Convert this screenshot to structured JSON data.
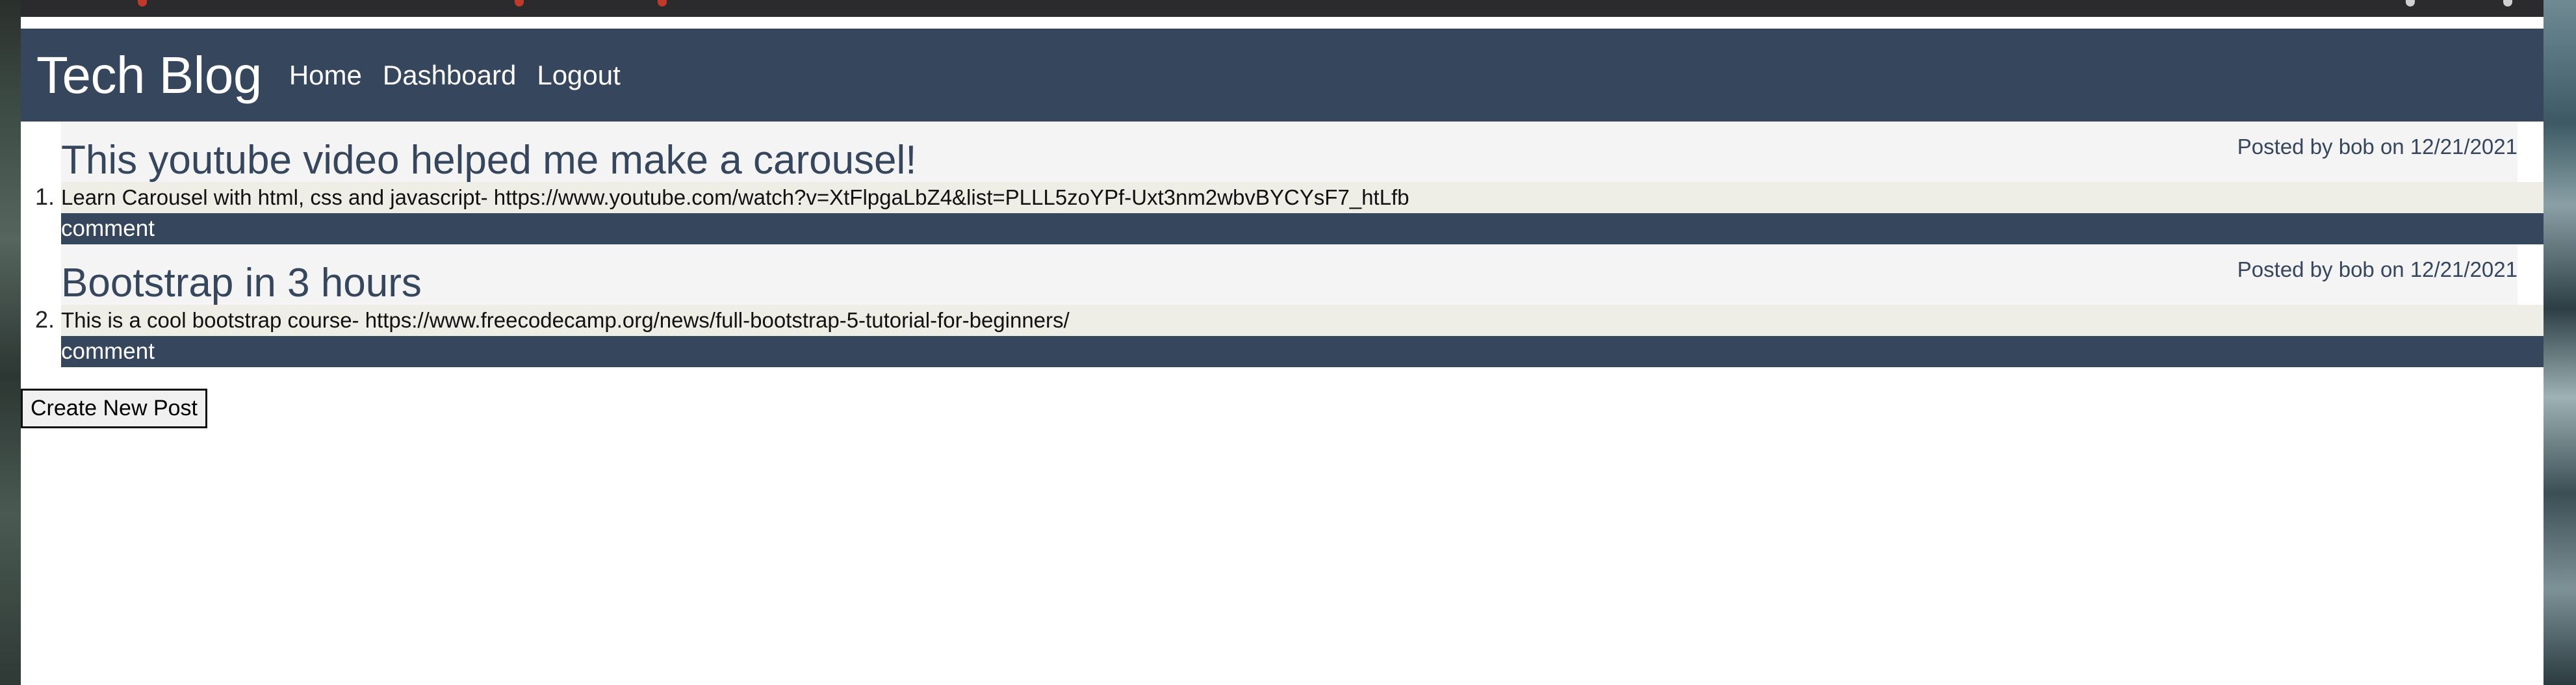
{
  "site": {
    "title": "Tech Blog"
  },
  "nav": {
    "items": [
      "Home",
      "Dashboard",
      "Logout"
    ]
  },
  "posts": [
    {
      "title": "This youtube video helped me make a carousel!",
      "meta": "Posted by bob on 12/21/2021",
      "body": "Learn Carousel with html, css and javascript- https://www.youtube.com/watch?v=XtFlpgaLbZ4&list=PLLL5zoYPf-Uxt3nm2wbvBYCYsF7_htLfb",
      "comment_label": "comment"
    },
    {
      "title": "Bootstrap in 3 hours",
      "meta": "Posted by bob on 12/21/2021",
      "body": "This is a cool bootstrap course- https://www.freecodecamp.org/news/full-bootstrap-5-tutorial-for-beginners/",
      "comment_label": "comment"
    }
  ],
  "actions": {
    "create_post_label": "Create New Post"
  },
  "colors": {
    "header_bg": "#36465d",
    "post_head_bg": "#f4f4f4",
    "post_body_bg": "#eeede6",
    "comment_bg": "#36465d"
  }
}
